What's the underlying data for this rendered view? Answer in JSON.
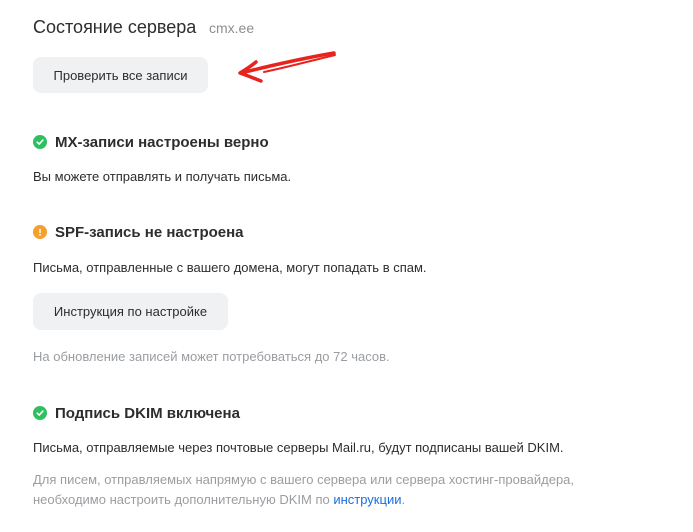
{
  "header": {
    "title": "Состояние сервера",
    "domain": "cmx.ee"
  },
  "check_button": {
    "label": "Проверить все записи"
  },
  "annotation": {
    "arrow_color": "#e8231d"
  },
  "status_colors": {
    "ok": "#2dbf62",
    "warn": "#f4a02a",
    "link": "#1a6fe0"
  },
  "mx": {
    "status": "ok",
    "icon": "check-icon",
    "title": "MX-записи настроены верно",
    "description": "Вы можете отправлять и получать письма."
  },
  "spf": {
    "status": "warn",
    "icon": "exclamation-icon",
    "title": "SPF-запись не настроена",
    "description": "Письма, отправленные с вашего домена, могут попадать в спам.",
    "button_label": "Инструкция по настройке",
    "update_note": "На обновление записей может потребоваться до 72 часов."
  },
  "dkim": {
    "status": "ok",
    "icon": "check-icon",
    "title": "Подпись DKIM включена",
    "description": "Письма, отправляемые через почтовые серверы Mail.ru, будут подписаны вашей DKIM.",
    "note_line1": "Для писем, отправляемых напрямую с вашего сервера или сервера хостинг-провайдера,",
    "note_line2_prefix": "необходимо настроить дополнительную DKIM по ",
    "note_link": "инструкции",
    "note_suffix": "."
  }
}
